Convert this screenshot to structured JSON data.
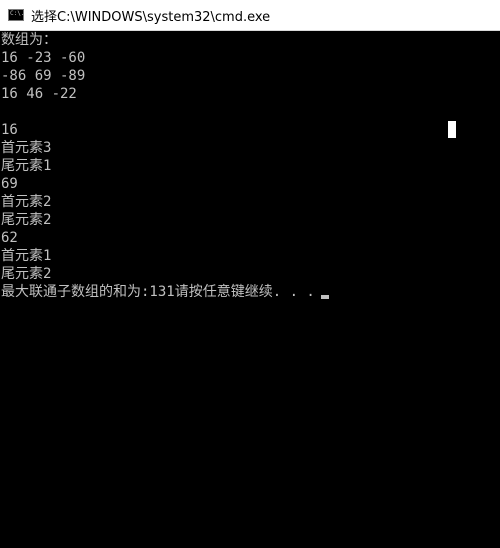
{
  "window": {
    "title": "选择C:\\WINDOWS\\system32\\cmd.exe",
    "icon": "console-icon",
    "icon_text": "C:\\."
  },
  "console": {
    "lines": [
      "数组为：",
      "16 -23 -60",
      "-86 69 -89",
      "16 46 -22",
      "",
      "16",
      "首元素3",
      "尾元素1",
      "69",
      "首元素2",
      "尾元素2",
      "62",
      "首元素1",
      "尾元素2",
      "最大联通子数组的和为:131请按任意键继续. . ."
    ]
  },
  "colors": {
    "console_bg": "#000000",
    "console_text": "#c0c0c0",
    "titlebar_bg": "#ffffff"
  }
}
